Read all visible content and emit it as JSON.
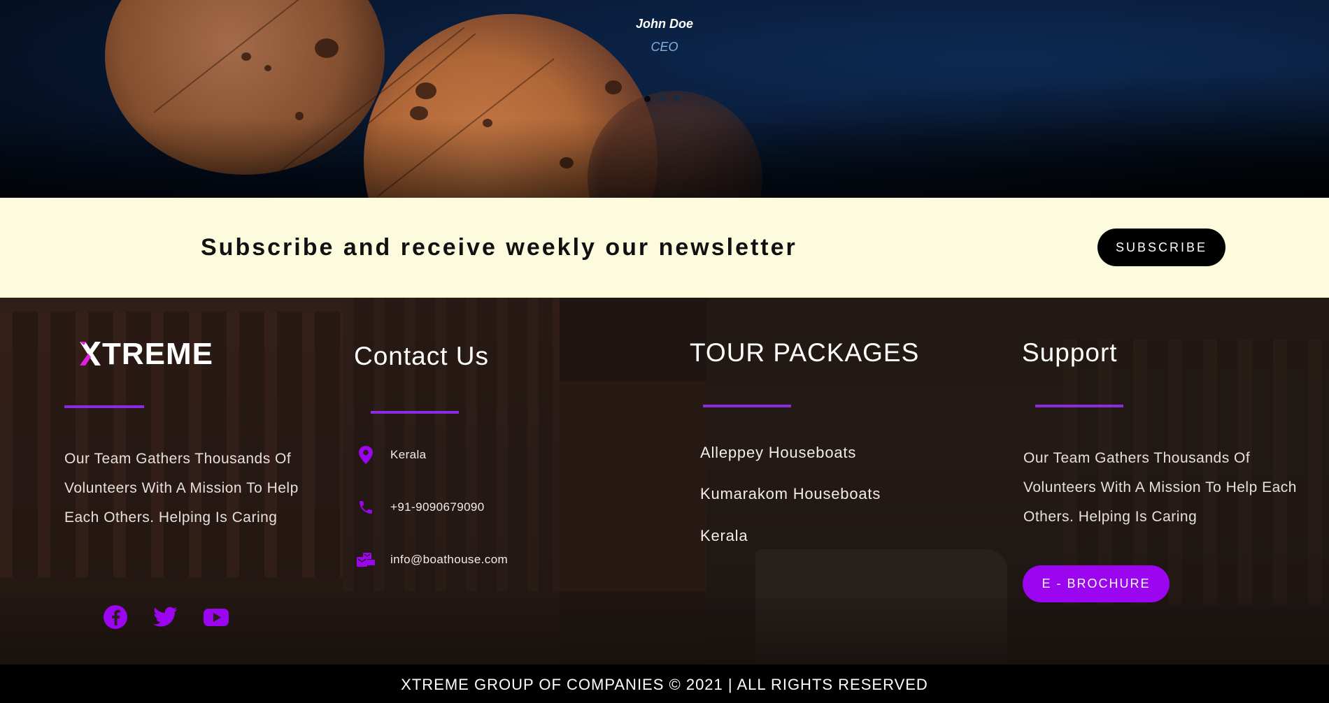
{
  "testimonial": {
    "author_name": "John Doe",
    "author_role": "CEO",
    "slide_count": 3,
    "active_slide": 1
  },
  "newsletter": {
    "text": "Subscribe and receive weekly our newsletter",
    "button_label": "SUBSCRIBE"
  },
  "footer": {
    "logo_text": "TREME",
    "logo_alt": "XTREME",
    "about_text": "Our Team Gathers Thousands Of Volunteers With A Mission To Help Each Others. Helping Is Caring",
    "social": [
      {
        "name": "facebook-icon"
      },
      {
        "name": "twitter-icon"
      },
      {
        "name": "youtube-icon"
      }
    ],
    "contact": {
      "heading": "Contact Us",
      "location": "Kerala",
      "phone": "+91-9090679090",
      "email": "info@boathouse.com"
    },
    "packages": {
      "heading": "TOUR PACKAGES",
      "items": [
        "Alleppey Houseboats",
        "Kumarakom Houseboats",
        "Kerala"
      ]
    },
    "support": {
      "heading": "Support",
      "text": "Our Team Gathers Thousands Of Volunteers With A Mission To Help Each Others. Helping Is Caring",
      "button_label": "E - BROCHURE"
    },
    "copyright": "XTREME GROUP OF COMPANIES © 2021 | ALL RIGHTS RESERVED"
  },
  "colors": {
    "accent": "#9b05f0",
    "underline": "#8a2be2",
    "newsletter_bg": "#fdfbdd",
    "role_text": "#7fb2e0"
  }
}
